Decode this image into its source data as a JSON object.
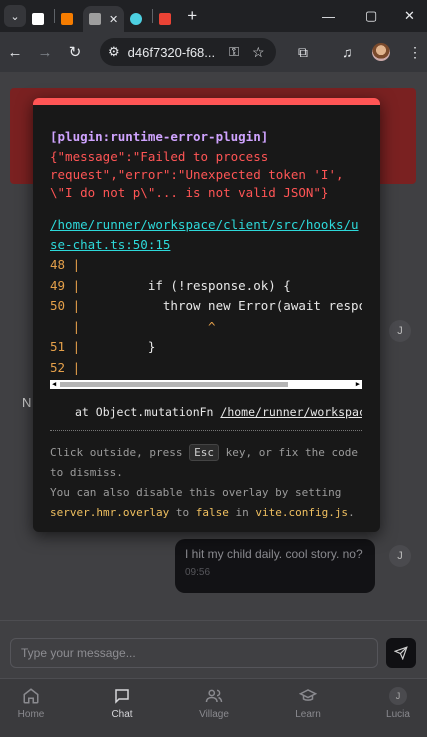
{
  "browser": {
    "tabs": [
      {
        "label": "",
        "color": "#ffffff"
      },
      {
        "label": "",
        "color": "#f57c00"
      },
      {
        "label": "",
        "color": "#9e9e9e",
        "active": true
      },
      {
        "label": "",
        "color": "#4dd0e1"
      },
      {
        "label": "",
        "color": "#ea4335"
      }
    ],
    "new_tab_glyph": "+",
    "url": "d46f7320-f68..."
  },
  "overlay": {
    "plugin": "[plugin:runtime-error-plugin]",
    "message": "{\"message\":\"Failed to process\nrequest\",\"error\":\"Unexpected token 'I',\n\\\"I do not p\\\"... is not valid JSON\"}",
    "file": "/home/runner/workspace/client/src/hooks/use-chat.ts:50:15",
    "code_lines": [
      {
        "num": "48",
        "src": ""
      },
      {
        "num": "49",
        "src": "        if (!response.ok) {"
      },
      {
        "num": "50",
        "src": "          throw new Error(await respo"
      },
      {
        "num": "  ",
        "src": "                ^"
      },
      {
        "num": "51",
        "src": "        }"
      },
      {
        "num": "52",
        "src": ""
      }
    ],
    "stack_prefix": "at Object.mutationFn ",
    "stack_path": "/home/runner/workspace/client",
    "tip_1a": "Click outside, press ",
    "tip_key": "Esc",
    "tip_1b": " key, or fix the code to dismiss.",
    "tip_2a": "You can also disable this overlay by setting ",
    "tip_cfg_a": "server.hmr.overlay",
    "tip_2b": " to ",
    "tip_cfg_b": "false",
    "tip_2c": " in ",
    "tip_cfg_c": "vite.config.js",
    "tip_2d": "."
  },
  "chat": {
    "peek_letter": "N",
    "avatar_letter": "J",
    "user_message": "I hit my child daily. cool story. no?",
    "user_time": "09:56",
    "input_placeholder": "Type your message..."
  },
  "nav": {
    "home": "Home",
    "chat": "Chat",
    "village": "Village",
    "learn": "Learn",
    "lucia": "Lucia",
    "lucia_initial": "J"
  }
}
